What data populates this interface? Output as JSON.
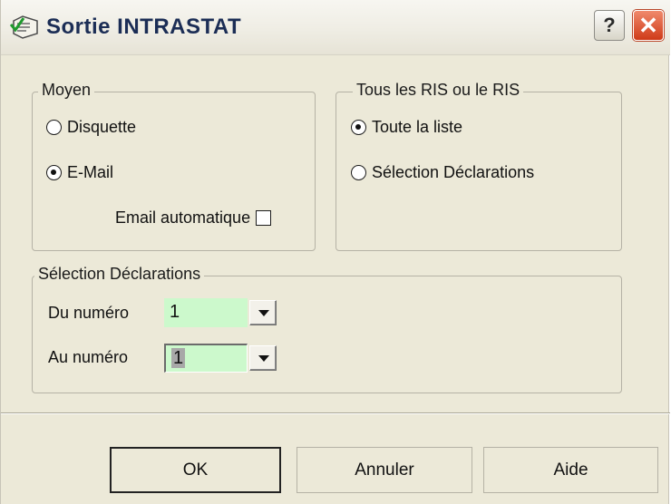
{
  "window": {
    "title": "Sortie INTRASTAT",
    "help_label": "?",
    "close_label": "✕",
    "app_icon": "printer-check-icon"
  },
  "moyen": {
    "legend": "Moyen",
    "options": [
      {
        "label": "Disquette",
        "checked": false
      },
      {
        "label": "E-Mail",
        "checked": true
      }
    ],
    "email_auto_label": "Email automatique",
    "email_auto_checked": false
  },
  "ris": {
    "legend": "Tous les RIS ou le RIS",
    "options": [
      {
        "label": "Toute la liste",
        "checked": true
      },
      {
        "label": "Sélection Déclarations",
        "checked": false
      }
    ]
  },
  "selection": {
    "legend": "Sélection Déclarations",
    "from_label": "Du numéro",
    "from_value": "1",
    "to_label": "Au numéro",
    "to_value": "1"
  },
  "buttons": {
    "ok": "OK",
    "cancel": "Annuler",
    "help": "Aide"
  },
  "colors": {
    "dialog_bg": "#ece9d8",
    "field_bg": "#ccf9cc",
    "close_red": "#cf3a18",
    "title_text": "#1b2d55"
  }
}
